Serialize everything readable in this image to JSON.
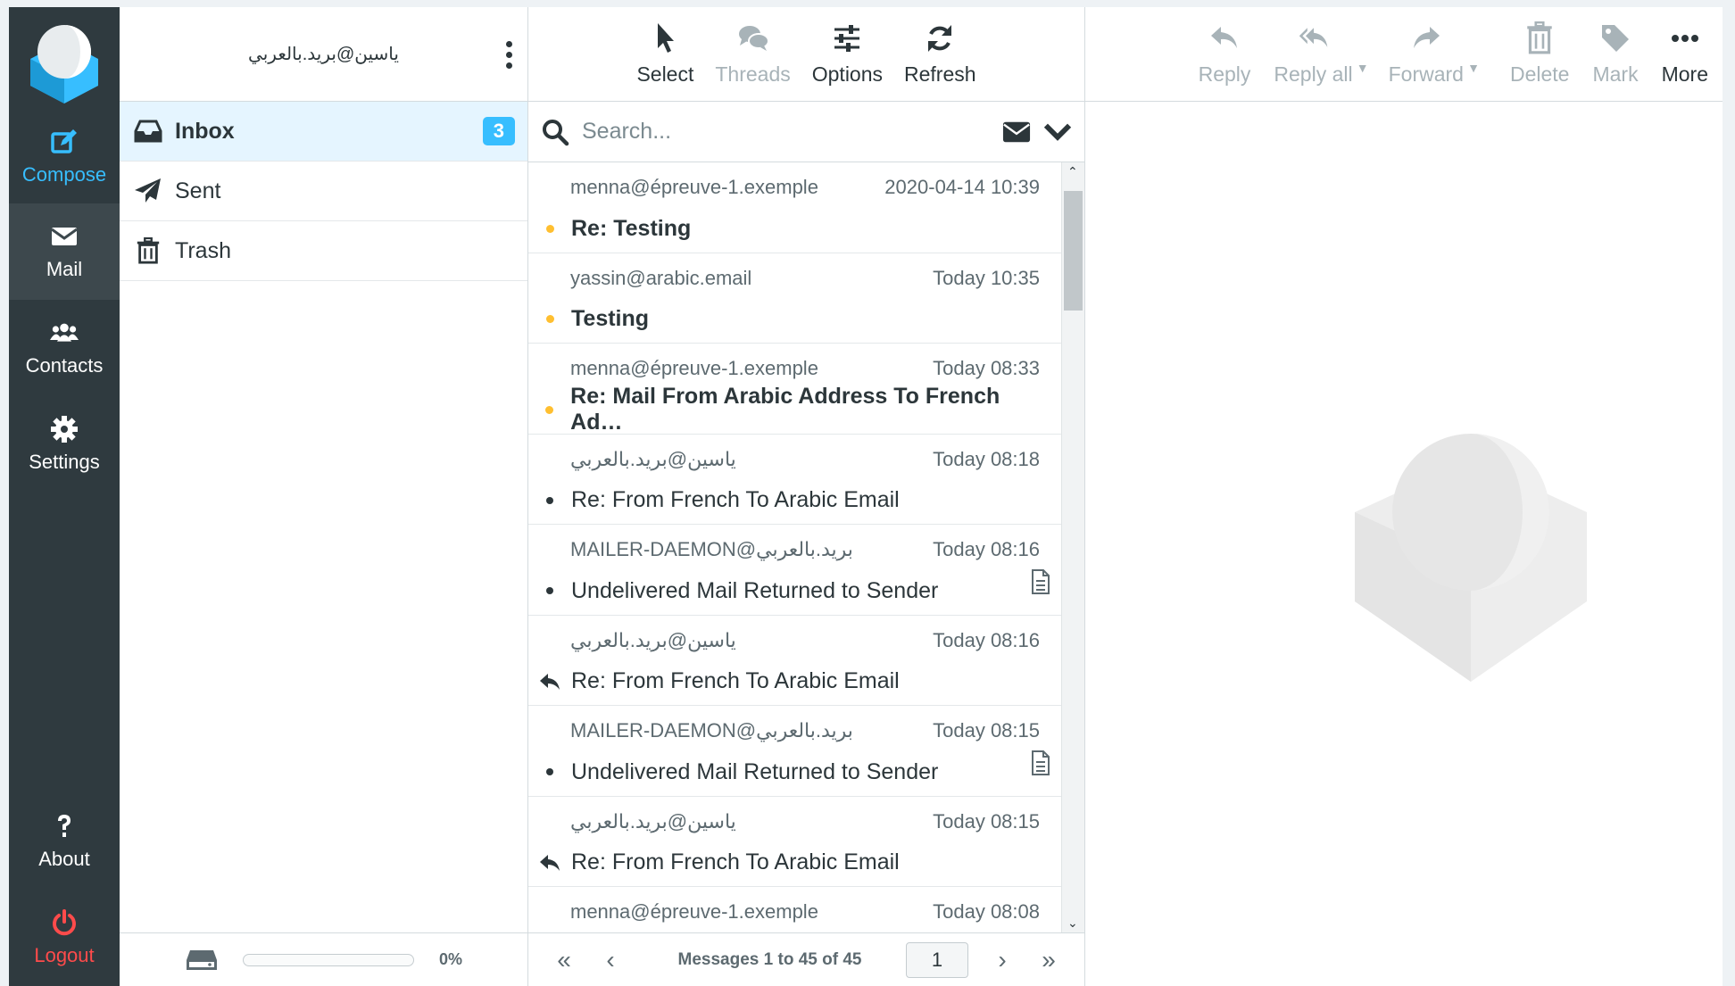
{
  "taskbar": {
    "items": [
      {
        "label": "Compose",
        "icon": "compose-icon"
      },
      {
        "label": "Mail",
        "icon": "mail-icon"
      },
      {
        "label": "Contacts",
        "icon": "contacts-icon"
      },
      {
        "label": "Settings",
        "icon": "gear-icon"
      },
      {
        "label": "About",
        "icon": "question-icon"
      },
      {
        "label": "Logout",
        "icon": "power-icon"
      }
    ],
    "accent_color": "#37beff",
    "logout_color": "#ff4b4b"
  },
  "account": {
    "name": "ياسين@بريد.بالعربي"
  },
  "folders": [
    {
      "label": "Inbox",
      "unread": "3"
    },
    {
      "label": "Sent"
    },
    {
      "label": "Trash"
    }
  ],
  "quota": {
    "percent_label": "0%",
    "fraction": 0
  },
  "list_toolbar": {
    "select": "Select",
    "threads": "Threads",
    "options": "Options",
    "refresh": "Refresh"
  },
  "search": {
    "placeholder": "Search..."
  },
  "messages": [
    {
      "from": "menna@épreuve-1.exemple",
      "date": "2020-04-14 10:39",
      "subject": "Re: Testing",
      "unread": true,
      "status": "unread"
    },
    {
      "from": "yassin@arabic.email",
      "date": "Today 10:35",
      "subject": "Testing",
      "unread": true,
      "status": "unread"
    },
    {
      "from": "menna@épreuve-1.exemple",
      "date": "Today 08:33",
      "subject": "Re: Mail From Arabic Address To French Ad…",
      "unread": true,
      "status": "unread"
    },
    {
      "from": "ياسين@بريد.بالعربي",
      "date": "Today 08:18",
      "subject": "Re: From French To Arabic Email",
      "unread": false,
      "status": "read"
    },
    {
      "from": "MAILER-DAEMON@بريد.بالعربي",
      "date": "Today 08:16",
      "subject": "Undelivered Mail Returned to Sender",
      "unread": false,
      "status": "read",
      "attachment": true
    },
    {
      "from": "ياسين@بريد.بالعربي",
      "date": "Today 08:16",
      "subject": "Re: From French To Arabic Email",
      "unread": false,
      "status": "replied"
    },
    {
      "from": "MAILER-DAEMON@بريد.بالعربي",
      "date": "Today 08:15",
      "subject": "Undelivered Mail Returned to Sender",
      "unread": false,
      "status": "read",
      "attachment": true
    },
    {
      "from": "ياسين@بريد.بالعربي",
      "date": "Today 08:15",
      "subject": "Re: From French To Arabic Email",
      "unread": false,
      "status": "replied"
    },
    {
      "from": "menna@épreuve-1.exemple",
      "date": "Today 08:08",
      "subject": "",
      "unread": false,
      "status": "read"
    }
  ],
  "pager": {
    "count": "Messages 1 to 45 of 45",
    "page": "1"
  },
  "preview_toolbar": {
    "reply": "Reply",
    "reply_all": "Reply all",
    "forward": "Forward",
    "delete": "Delete",
    "mark": "Mark",
    "more": "More"
  }
}
